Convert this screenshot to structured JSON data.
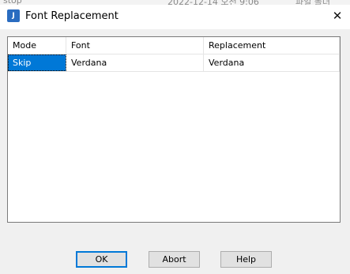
{
  "background": {
    "text_left": "stop",
    "text_middle": "2022-12-14 오전 9:06",
    "text_right": "파일 폴더"
  },
  "window": {
    "title": "Font Replacement",
    "icon": "app-logo-icon",
    "close_icon": "close-icon",
    "close_glyph": "✕"
  },
  "table": {
    "columns": [
      "Mode",
      "Font",
      "Replacement"
    ],
    "rows": [
      {
        "mode": "Skip",
        "font": "Verdana",
        "replacement": "Verdana",
        "selected": true
      }
    ]
  },
  "buttons": {
    "ok": "OK",
    "abort": "Abort",
    "help": "Help"
  },
  "colors": {
    "selection": "#0078d7",
    "default_button_border": "#0078d7",
    "dialog_background": "#f0f0f0"
  }
}
